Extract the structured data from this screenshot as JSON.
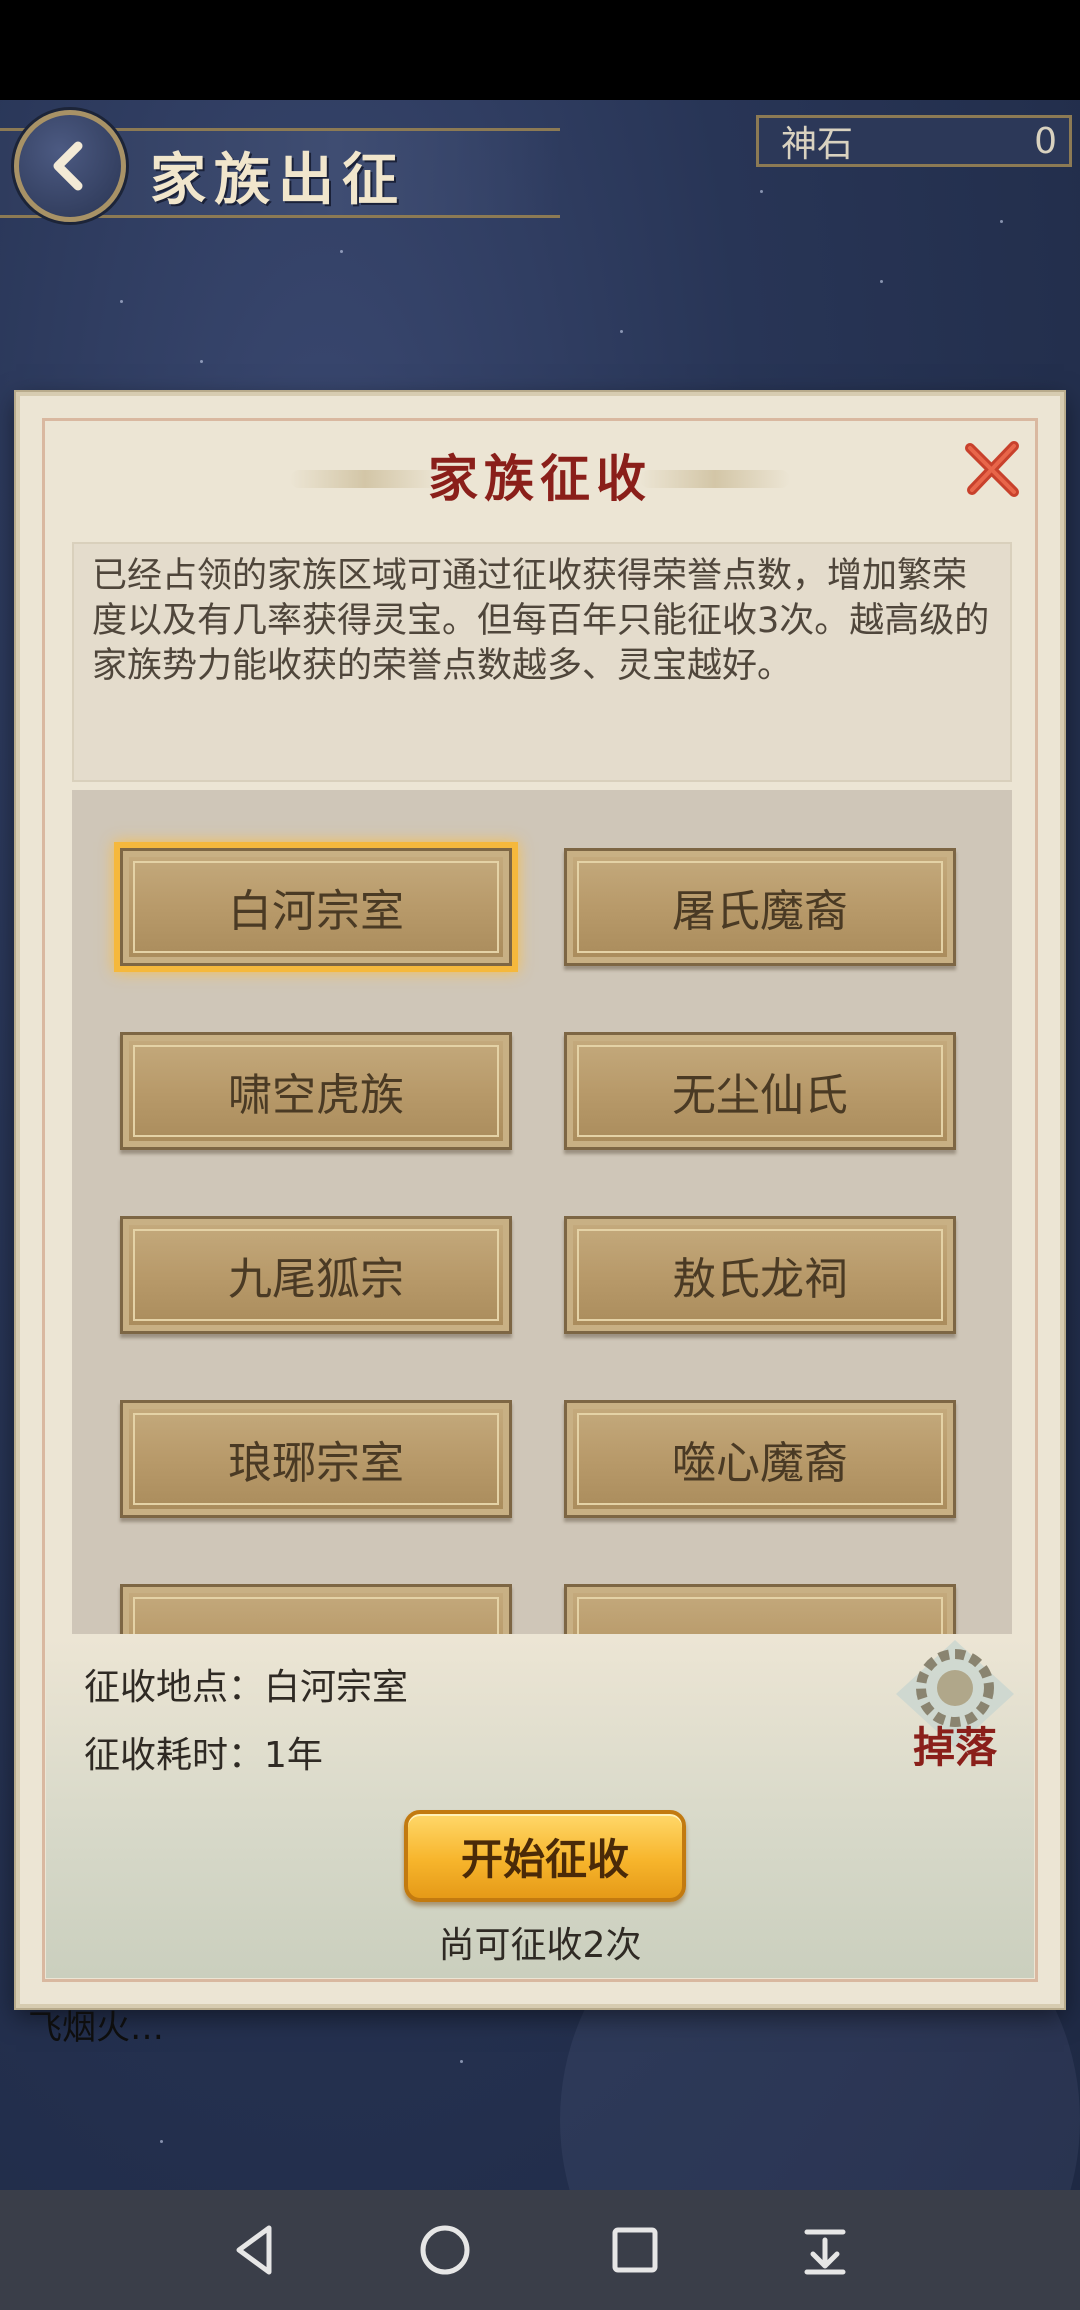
{
  "header": {
    "title": "家族出征",
    "currency_label": "神石",
    "currency_value": "0"
  },
  "dialog": {
    "title": "家族征收",
    "description": "已经占领的家族区域可通过征收获得荣誉点数，增加繁荣度以及有几率获得灵宝。但每百年只能征收3次。越高级的家族势力能收获的荣誉点数越多、灵宝越好。",
    "regions": [
      {
        "label": "白河宗室",
        "selected": true
      },
      {
        "label": "屠氏魔裔",
        "selected": false
      },
      {
        "label": "啸空虎族",
        "selected": false
      },
      {
        "label": "无尘仙氏",
        "selected": false
      },
      {
        "label": "九尾狐宗",
        "selected": false
      },
      {
        "label": "敖氏龙祠",
        "selected": false
      },
      {
        "label": "琅琊宗室",
        "selected": false
      },
      {
        "label": "噬心魔裔",
        "selected": false
      }
    ],
    "location_text": "征收地点：白河宗室",
    "duration_text": "征收耗时：1年",
    "drop_label": "掉落",
    "start_button": "开始征收",
    "remaining_text": "尚可征收2次"
  },
  "chat_snippet": "飞烟火…",
  "icons": {
    "back": "back-arrow-icon",
    "close": "close-x-icon",
    "drop": "drop-gear-icon",
    "nav_back": "nav-back-triangle-icon",
    "nav_home": "nav-home-circle-icon",
    "nav_recent": "nav-recent-square-icon",
    "nav_download": "nav-download-icon"
  },
  "colors": {
    "dialog_title": "#8a1f1a",
    "selected_glow": "#f5b83c",
    "start_button": "#f7b52c"
  }
}
